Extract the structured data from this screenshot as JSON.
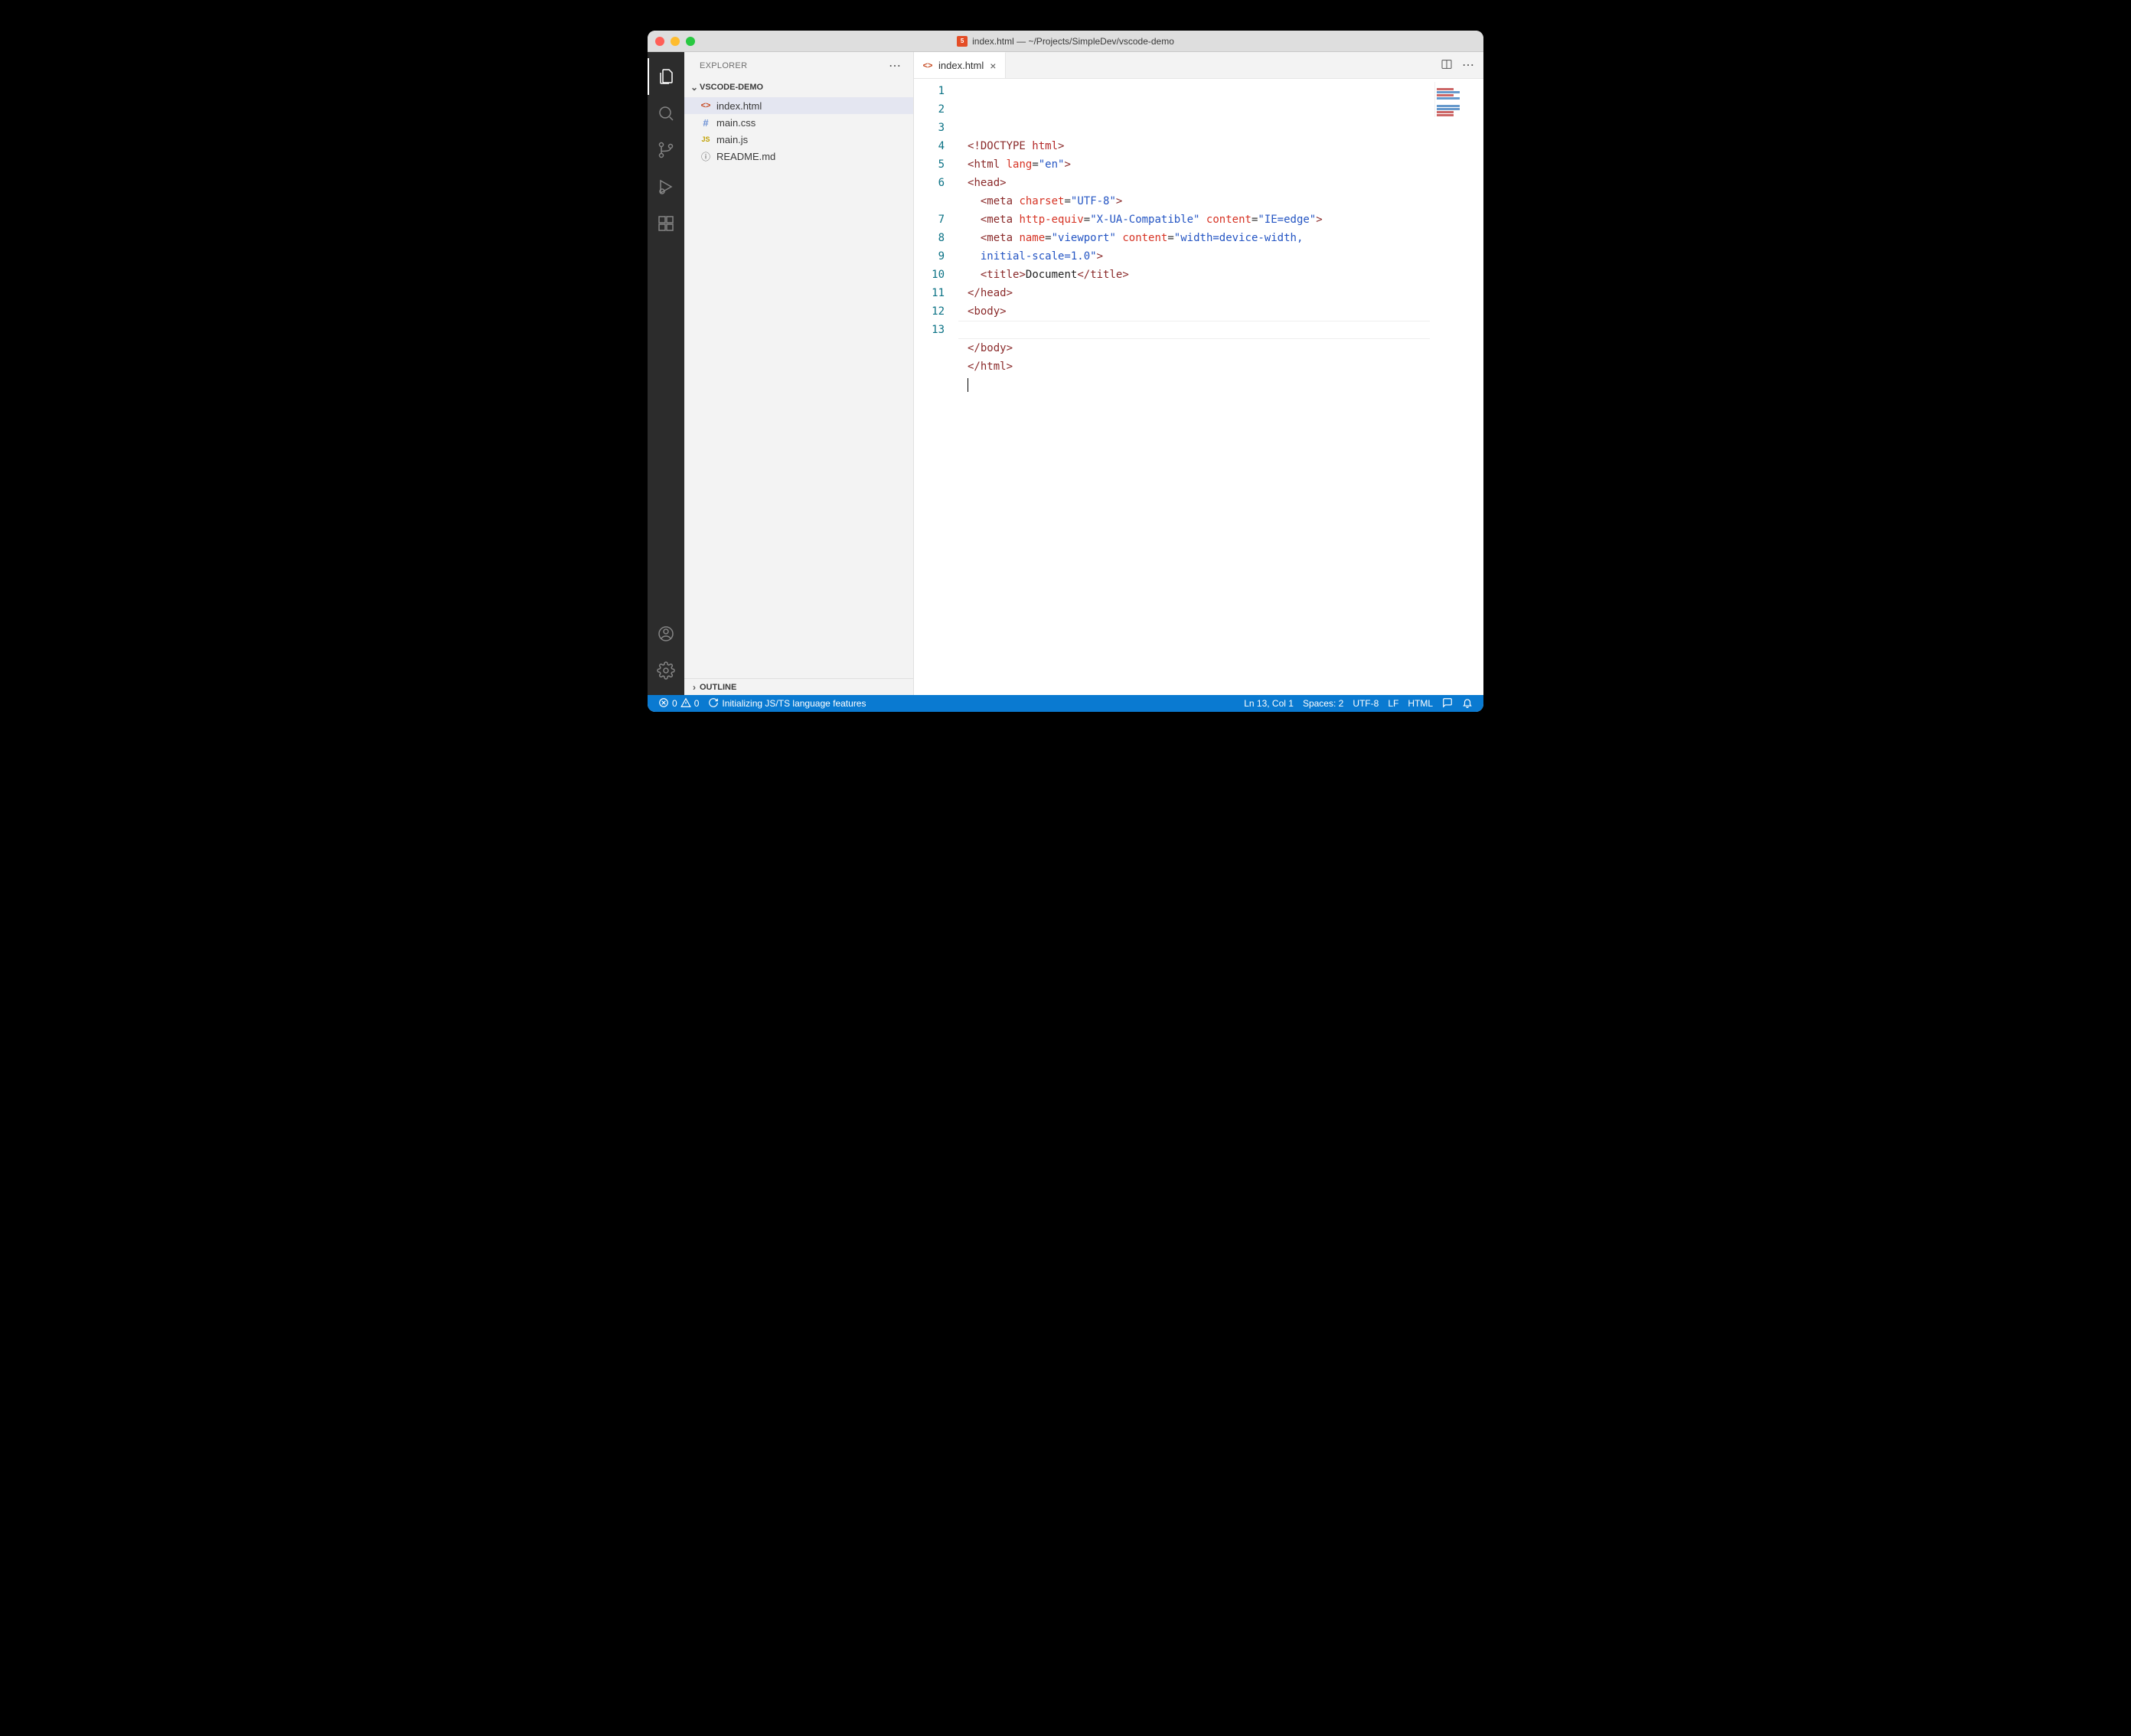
{
  "window": {
    "title": "index.html — ~/Projects/SimpleDev/vscode-demo"
  },
  "sidebar": {
    "title": "EXPLORER",
    "project": "VSCODE-DEMO",
    "files": [
      {
        "name": "index.html",
        "iconClass": "ico-html",
        "iconText": "<>",
        "selected": true
      },
      {
        "name": "main.css",
        "iconClass": "ico-css",
        "iconText": "#",
        "selected": false
      },
      {
        "name": "main.js",
        "iconClass": "ico-js",
        "iconText": "JS",
        "selected": false
      },
      {
        "name": "README.md",
        "iconClass": "ico-info",
        "iconText": "ⓘ",
        "selected": false
      }
    ],
    "outline": "OUTLINE"
  },
  "tabs": {
    "open": "index.html"
  },
  "editor": {
    "lines": [
      [
        {
          "t": "<!",
          "c": "c-punct"
        },
        {
          "t": "DOCTYPE ",
          "c": "c-doctype"
        },
        {
          "t": "html",
          "c": "c-doctype-kw"
        },
        {
          "t": ">",
          "c": "c-punct"
        }
      ],
      [
        {
          "t": "<",
          "c": "c-punct"
        },
        {
          "t": "html ",
          "c": "c-tag"
        },
        {
          "t": "lang",
          "c": "c-attr"
        },
        {
          "t": "=",
          "c": "c-eq"
        },
        {
          "t": "\"en\"",
          "c": "c-attr-val"
        },
        {
          "t": ">",
          "c": "c-punct"
        }
      ],
      [
        {
          "t": "<",
          "c": "c-punct"
        },
        {
          "t": "head",
          "c": "c-tag"
        },
        {
          "t": ">",
          "c": "c-punct"
        }
      ],
      [
        {
          "t": "  ",
          "c": "indent-guide"
        },
        {
          "t": "<",
          "c": "c-punct"
        },
        {
          "t": "meta ",
          "c": "c-tag"
        },
        {
          "t": "charset",
          "c": "c-attr"
        },
        {
          "t": "=",
          "c": "c-eq"
        },
        {
          "t": "\"UTF-8\"",
          "c": "c-attr-val"
        },
        {
          "t": ">",
          "c": "c-punct"
        }
      ],
      [
        {
          "t": "  ",
          "c": "indent-guide"
        },
        {
          "t": "<",
          "c": "c-punct"
        },
        {
          "t": "meta ",
          "c": "c-tag"
        },
        {
          "t": "http-equiv",
          "c": "c-attr"
        },
        {
          "t": "=",
          "c": "c-eq"
        },
        {
          "t": "\"X-UA-Compatible\"",
          "c": "c-attr-val"
        },
        {
          "t": " ",
          "c": ""
        },
        {
          "t": "content",
          "c": "c-attr"
        },
        {
          "t": "=",
          "c": "c-eq"
        },
        {
          "t": "\"IE=edge\"",
          "c": "c-attr-val"
        },
        {
          "t": ">",
          "c": "c-punct"
        }
      ],
      [
        {
          "t": "  ",
          "c": "indent-guide"
        },
        {
          "t": "<",
          "c": "c-punct"
        },
        {
          "t": "meta ",
          "c": "c-tag"
        },
        {
          "t": "name",
          "c": "c-attr"
        },
        {
          "t": "=",
          "c": "c-eq"
        },
        {
          "t": "\"viewport\"",
          "c": "c-attr-val"
        },
        {
          "t": " ",
          "c": ""
        },
        {
          "t": "content",
          "c": "c-attr"
        },
        {
          "t": "=",
          "c": "c-eq"
        },
        {
          "t": "\"width=device-width, ",
          "c": "c-attr-val"
        }
      ],
      [
        {
          "t": "  ",
          "c": "indent-guide"
        },
        {
          "t": "initial-scale=1.0\"",
          "c": "c-attr-val"
        },
        {
          "t": ">",
          "c": "c-punct"
        }
      ],
      [
        {
          "t": "  ",
          "c": "indent-guide"
        },
        {
          "t": "<",
          "c": "c-punct"
        },
        {
          "t": "title",
          "c": "c-tag"
        },
        {
          "t": ">",
          "c": "c-punct"
        },
        {
          "t": "Document",
          "c": "c-text"
        },
        {
          "t": "</",
          "c": "c-punct"
        },
        {
          "t": "title",
          "c": "c-tag"
        },
        {
          "t": ">",
          "c": "c-punct"
        }
      ],
      [
        {
          "t": "</",
          "c": "c-punct"
        },
        {
          "t": "head",
          "c": "c-tag"
        },
        {
          "t": ">",
          "c": "c-punct"
        }
      ],
      [
        {
          "t": "<",
          "c": "c-punct"
        },
        {
          "t": "body",
          "c": "c-tag"
        },
        {
          "t": ">",
          "c": "c-punct"
        }
      ],
      [
        {
          "t": "  ",
          "c": ""
        }
      ],
      [
        {
          "t": "</",
          "c": "c-punct"
        },
        {
          "t": "body",
          "c": "c-tag"
        },
        {
          "t": ">",
          "c": "c-punct"
        }
      ],
      [
        {
          "t": "</",
          "c": "c-punct"
        },
        {
          "t": "html",
          "c": "c-tag"
        },
        {
          "t": ">",
          "c": "c-punct"
        }
      ],
      [
        {
          "t": "",
          "c": ""
        }
      ]
    ],
    "lineNumbers": [
      "1",
      "2",
      "3",
      "4",
      "5",
      "6",
      "",
      "7",
      "8",
      "9",
      "10",
      "11",
      "12",
      "13"
    ],
    "cursorLineIndex": 13
  },
  "status": {
    "errors": "0",
    "warnings": "0",
    "init": "Initializing JS/TS language features",
    "lncol": "Ln 13, Col 1",
    "spaces": "Spaces: 2",
    "encoding": "UTF-8",
    "eol": "LF",
    "lang": "HTML"
  }
}
